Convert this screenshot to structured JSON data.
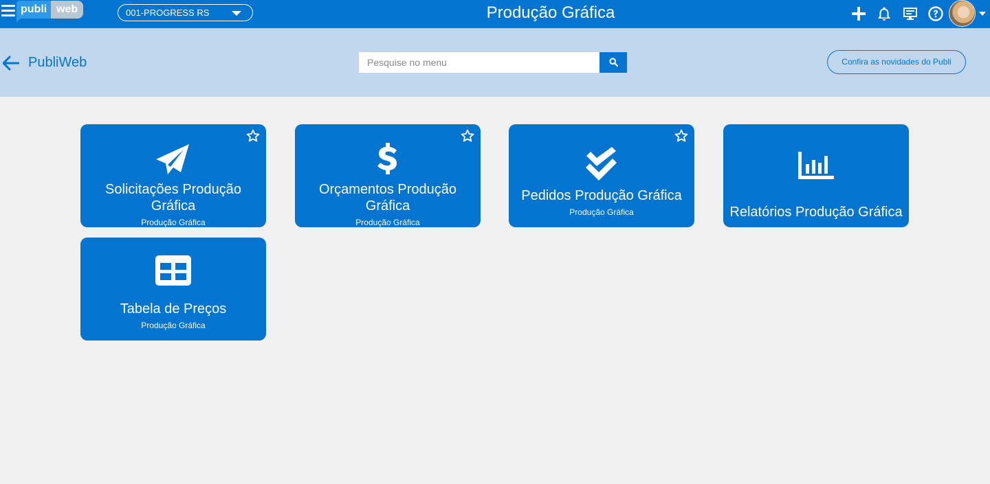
{
  "topbar": {
    "logo_left": "publi",
    "logo_right": "web",
    "company": "001-PROGRESS RS",
    "title": "Produção Gráfica",
    "icons": [
      "menu-icon",
      "plus-icon",
      "bell-icon",
      "monitor-icon",
      "help-icon",
      "avatar"
    ]
  },
  "subheader": {
    "app_name": "PubliWeb",
    "search_placeholder": "Pesquise no menu",
    "news_button": "Confira as novidades do Publi"
  },
  "cards": [
    {
      "title_line1": "Solicitações Produção",
      "title_line2": "Gráfica",
      "subtitle": "Produção Gráfica",
      "icon": "paper-plane-icon",
      "favorite_icon": "star-outline-icon"
    },
    {
      "title_line1": "Orçamentos Produção",
      "title_line2": "Gráfica",
      "subtitle": "Produção Gráfica",
      "icon": "dollar-icon",
      "favorite_icon": "star-outline-icon"
    },
    {
      "title": "Pedidos Produção Gráfica",
      "subtitle": "Produção Gráfica",
      "icon": "double-check-icon",
      "favorite_icon": "star-outline-icon"
    },
    {
      "title": "Relatórios Produção Gráfica",
      "icon": "bar-chart-icon"
    },
    {
      "title": "Tabela de Preços",
      "subtitle": "Produção Gráfica",
      "icon": "table-icon"
    }
  ],
  "colors": {
    "primary": "#0374d0",
    "subheader_bg": "#c0d7ee",
    "page_bg": "#f0f0f0"
  }
}
